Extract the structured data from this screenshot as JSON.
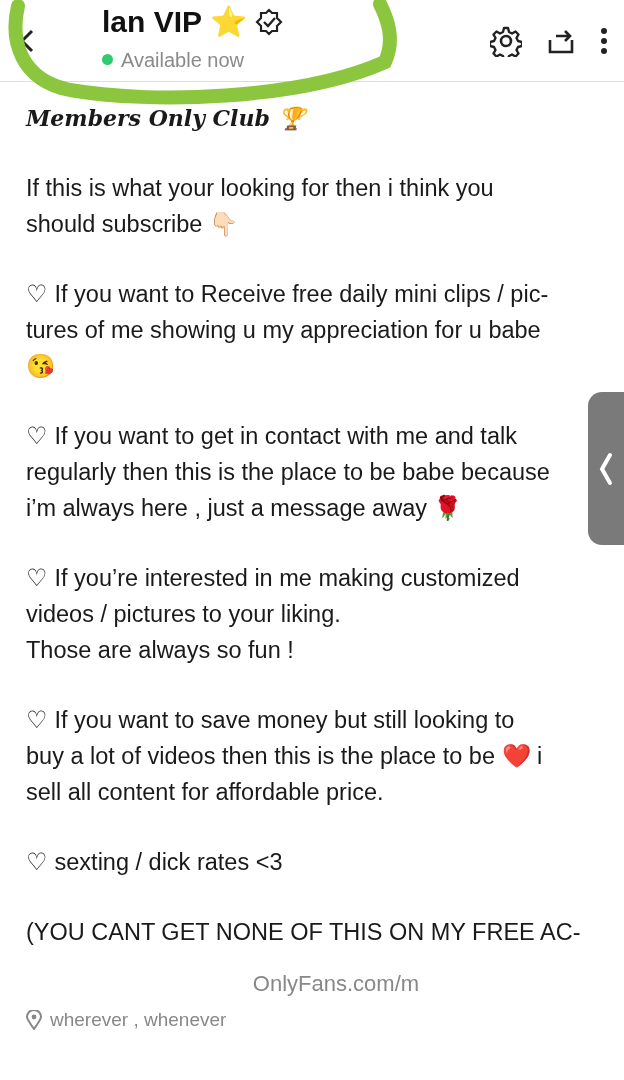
{
  "header": {
    "title": "lan VIP ⭐",
    "status": "Available now",
    "online": true
  },
  "bio": {
    "heading": "Members Only Club 🏆",
    "paragraphs": [
      {
        "lines": [
          "If this is what your looking for then i think you",
          "should subscribe 👇🏻"
        ]
      },
      {
        "lines": [
          "♡ If you want to Receive free daily mini clips / pic-",
          "tures of me showing u my appreciation for u babe",
          "😘"
        ]
      },
      {
        "lines": [
          "♡ If you want to get in contact with me and talk",
          "regularly then this is the place to be babe because",
          "i’m always here , just a message away 🌹"
        ]
      },
      {
        "lines": [
          "♡ If you’re interested in me making customized",
          "videos / pictures to your liking.",
          "Those are always so fun !"
        ]
      },
      {
        "lines": [
          "♡ If you want to save money but still looking to",
          "buy a lot of videos then this is the place to be ❤️ i",
          "sell all content for affordable price."
        ]
      },
      {
        "lines": [
          "♡ sexting / dick rates <3"
        ]
      },
      {
        "lines": [
          "(YOU CANT GET NONE OF THIS ON MY FREE AC-"
        ]
      }
    ]
  },
  "link": "OnlyFans.com/m",
  "location": "wherever , whenever"
}
